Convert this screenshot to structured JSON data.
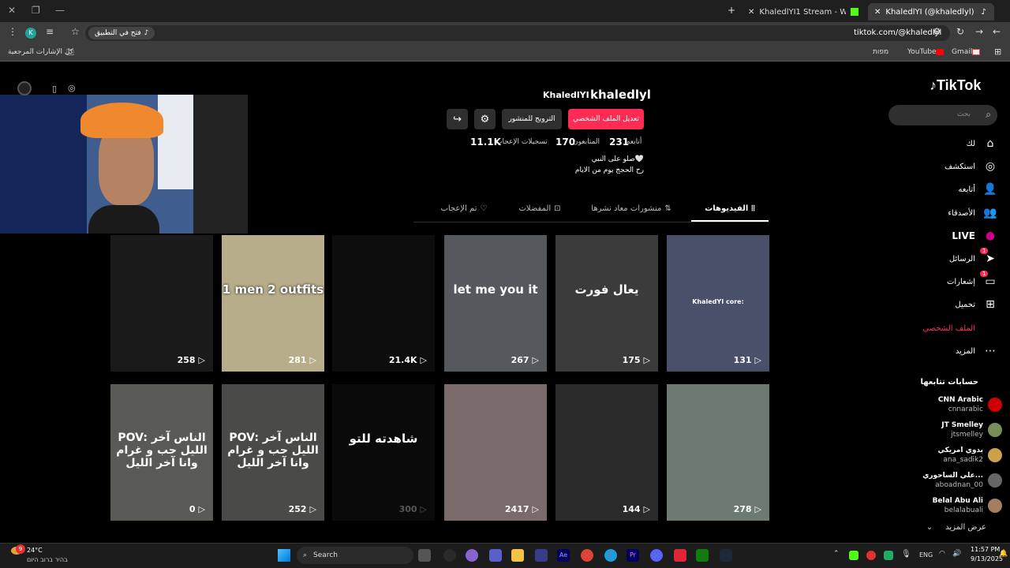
{
  "browser": {
    "tabs": [
      {
        "title": "KhaledlYI (@khaledlyl) | TikTok"
      },
      {
        "title": "KhaledlYI1 Stream - Watch Live"
      }
    ],
    "url": "tiktok.com/@khaledlyl",
    "open_in_app": "فتح في التطبيق",
    "bookmarks": {
      "all": "كل الإشارات المرجعية",
      "gmail": "Gmail",
      "youtube": "YouTube",
      "maps": "מפות"
    },
    "avatar_letter": "K"
  },
  "tiktok": {
    "logo": "TikTok",
    "search_placeholder": "بحث",
    "nav": [
      {
        "label": "لك",
        "icon": "home-icon"
      },
      {
        "label": "استكشف",
        "icon": "explore-icon"
      },
      {
        "label": "أتابعه",
        "icon": "following-icon"
      },
      {
        "label": "الأصدقاء",
        "icon": "friends-icon"
      },
      {
        "label": "LIVE",
        "icon": "live-icon"
      },
      {
        "label": "الرسائل",
        "icon": "messages-icon",
        "badge": "1"
      },
      {
        "label": "إشعارات",
        "icon": "notifications-icon",
        "badge": "1"
      },
      {
        "label": "تحميل",
        "icon": "upload-icon"
      },
      {
        "label": "الملف الشخصي",
        "icon": "profile-icon"
      },
      {
        "label": "المزيد",
        "icon": "more-icon"
      }
    ],
    "following_title": "حسابات تتابعها",
    "following": [
      {
        "name": "CNN Arabic",
        "handle": "cnnarabic"
      },
      {
        "name": "JT Smelley",
        "handle": "jtsmelley"
      },
      {
        "name": "بدوي امريكي",
        "handle": "ana_sadik2"
      },
      {
        "name": "علي الساحوري...",
        "handle": "aboadnan_00"
      },
      {
        "name": "Belal Abu Ali",
        "handle": "belalabuali"
      }
    ],
    "see_more": "عرض المزيد"
  },
  "profile": {
    "username": "khaledlyl",
    "display_name": "KhaledlYI",
    "edit_button": "تعديل الملف الشخصي",
    "promote_button": "الترويج للمنشور",
    "following_count": "231",
    "following_label": "أتابعه",
    "followers_count": "170",
    "followers_label": "المتابعون",
    "likes_count": "11.1K",
    "likes_label": "تسجيلات الإعجاب",
    "bio_line1": "صلو على النبي🤍",
    "bio_line2": "رح الحجج يوم من الايام",
    "tabs": [
      "الفيديوهات",
      "منشورات معاد نشرها",
      "المفضلات",
      "تم الإعجاب"
    ]
  },
  "videos": [
    {
      "views": "131",
      "caption": "KhaledYI core:"
    },
    {
      "views": "175",
      "caption": "يعال فورت"
    },
    {
      "views": "267",
      "caption": "let me you it"
    },
    {
      "views": "21.4K",
      "caption": ""
    },
    {
      "views": "281",
      "caption": "1 men 2 outfits"
    },
    {
      "views": "258",
      "caption": ""
    },
    {
      "views": "278",
      "caption": ""
    },
    {
      "views": "144",
      "caption": ""
    },
    {
      "views": "2417",
      "caption": ""
    },
    {
      "views": "300",
      "caption": "شاهدته للتو"
    },
    {
      "views": "252",
      "caption": "POV: الناس آخر الليل حب و غرام وانا آخر الليل"
    },
    {
      "views": "0",
      "caption": "POV: الناس آخر الليل حب و غرام وانا آخر الليل"
    }
  ],
  "taskbar": {
    "weather_temp": "24°C",
    "weather_text": "בהיר ברוב היום",
    "search": "Search",
    "lang": "ENG",
    "time": "11:57 PM",
    "date": "9/13/2025",
    "weather_badge": "9"
  },
  "colors": {
    "accent": "#fe2c55",
    "bg": "#000000",
    "chrome": "#3c3c3c"
  }
}
